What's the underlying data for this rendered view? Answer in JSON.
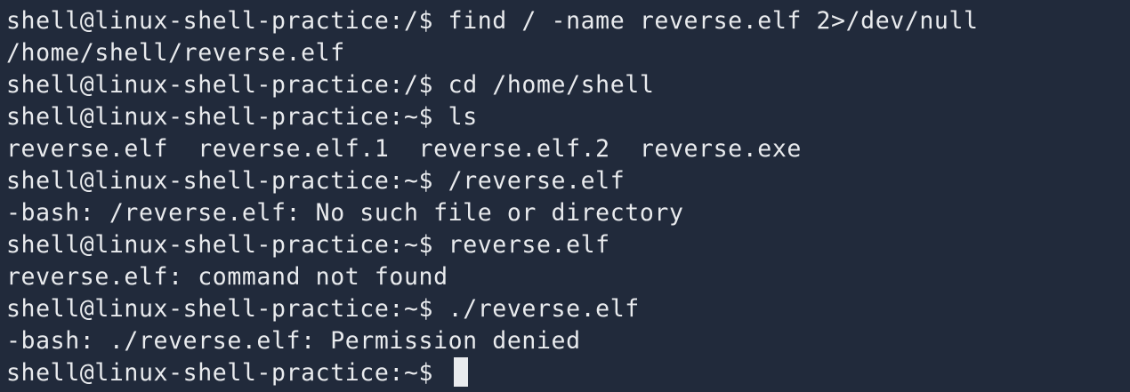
{
  "terminal": {
    "prompt_root": "shell@linux-shell-practice:/$ ",
    "prompt_home": "shell@linux-shell-practice:~$ ",
    "lines": [
      {
        "type": "command",
        "prompt": "shell@linux-shell-practice:/$ ",
        "command": "find / -name reverse.elf 2>/dev/null"
      },
      {
        "type": "output",
        "text": "/home/shell/reverse.elf"
      },
      {
        "type": "command",
        "prompt": "shell@linux-shell-practice:/$ ",
        "command": "cd /home/shell"
      },
      {
        "type": "command",
        "prompt": "shell@linux-shell-practice:~$ ",
        "command": "ls"
      },
      {
        "type": "output",
        "text": "reverse.elf  reverse.elf.1  reverse.elf.2  reverse.exe"
      },
      {
        "type": "command",
        "prompt": "shell@linux-shell-practice:~$ ",
        "command": "/reverse.elf"
      },
      {
        "type": "output",
        "text": "-bash: /reverse.elf: No such file or directory"
      },
      {
        "type": "command",
        "prompt": "shell@linux-shell-practice:~$ ",
        "command": "reverse.elf"
      },
      {
        "type": "output",
        "text": "reverse.elf: command not found"
      },
      {
        "type": "command",
        "prompt": "shell@linux-shell-practice:~$ ",
        "command": "./reverse.elf"
      },
      {
        "type": "output",
        "text": "-bash: ./reverse.elf: Permission denied"
      },
      {
        "type": "input",
        "prompt": "shell@linux-shell-practice:~$ ",
        "command": ""
      }
    ]
  },
  "colors": {
    "background": "#212a3b",
    "foreground": "#e9ebee"
  }
}
